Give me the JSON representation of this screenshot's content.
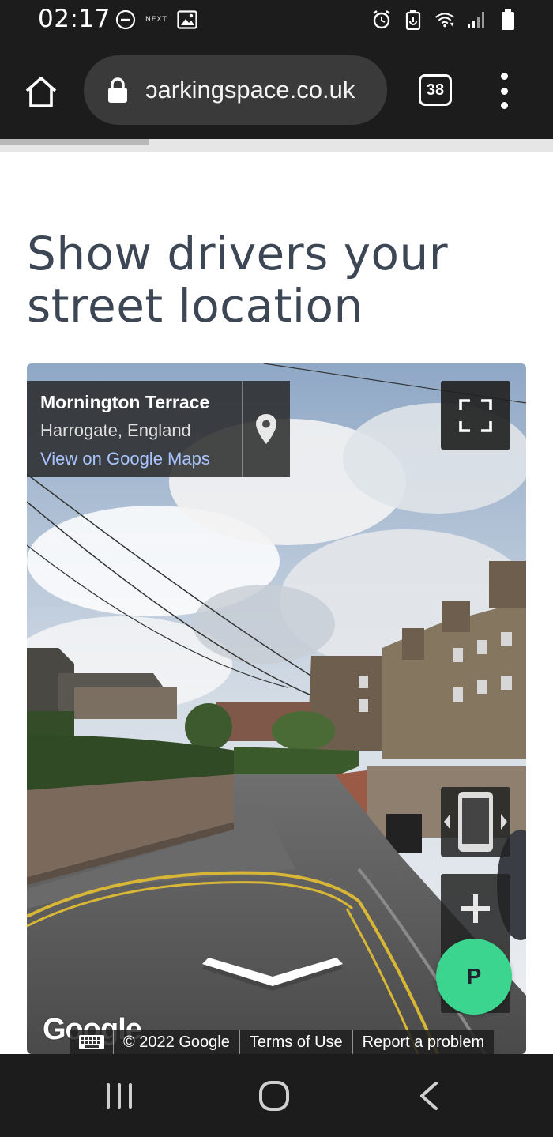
{
  "status_bar": {
    "time": "02:17",
    "next_label": "NEXT",
    "icons": [
      "do-not-disturb-icon",
      "next-app-icon",
      "image-icon",
      "alarm-icon",
      "battery-saver-icon",
      "wifi-icon",
      "signal-icon",
      "battery-icon"
    ]
  },
  "browser": {
    "url": "ɔarkingspace.co.uk",
    "tab_count": "38",
    "page_load_progress": 0.27,
    "icons": [
      "home-icon",
      "lock-icon",
      "tabs-icon",
      "more-vert-icon"
    ]
  },
  "page": {
    "headline": "Show drivers your street location"
  },
  "street_view": {
    "place_name": "Mornington Terrace",
    "place_region": "Harrogate, England",
    "maps_link": "View on Google Maps",
    "google_logo": "Google",
    "copyright": "© 2022 Google",
    "terms": "Terms of Use",
    "report": "Report a problem",
    "zoom_in_label": "+",
    "icons": [
      "map-pin-icon",
      "fullscreen-icon",
      "rotate-device-icon",
      "zoom-in-icon",
      "navigate-forward-arrow-icon",
      "keyboard-icon"
    ]
  },
  "fab": {
    "label": "P",
    "color": "#3bd58f"
  },
  "nav_bar": {
    "icons": [
      "recents-icon",
      "home-circle-icon",
      "back-icon"
    ]
  },
  "colors": {
    "headline": "#3d4654",
    "link": "#a9c4ff",
    "chrome_dark": "#1c1c1c"
  }
}
